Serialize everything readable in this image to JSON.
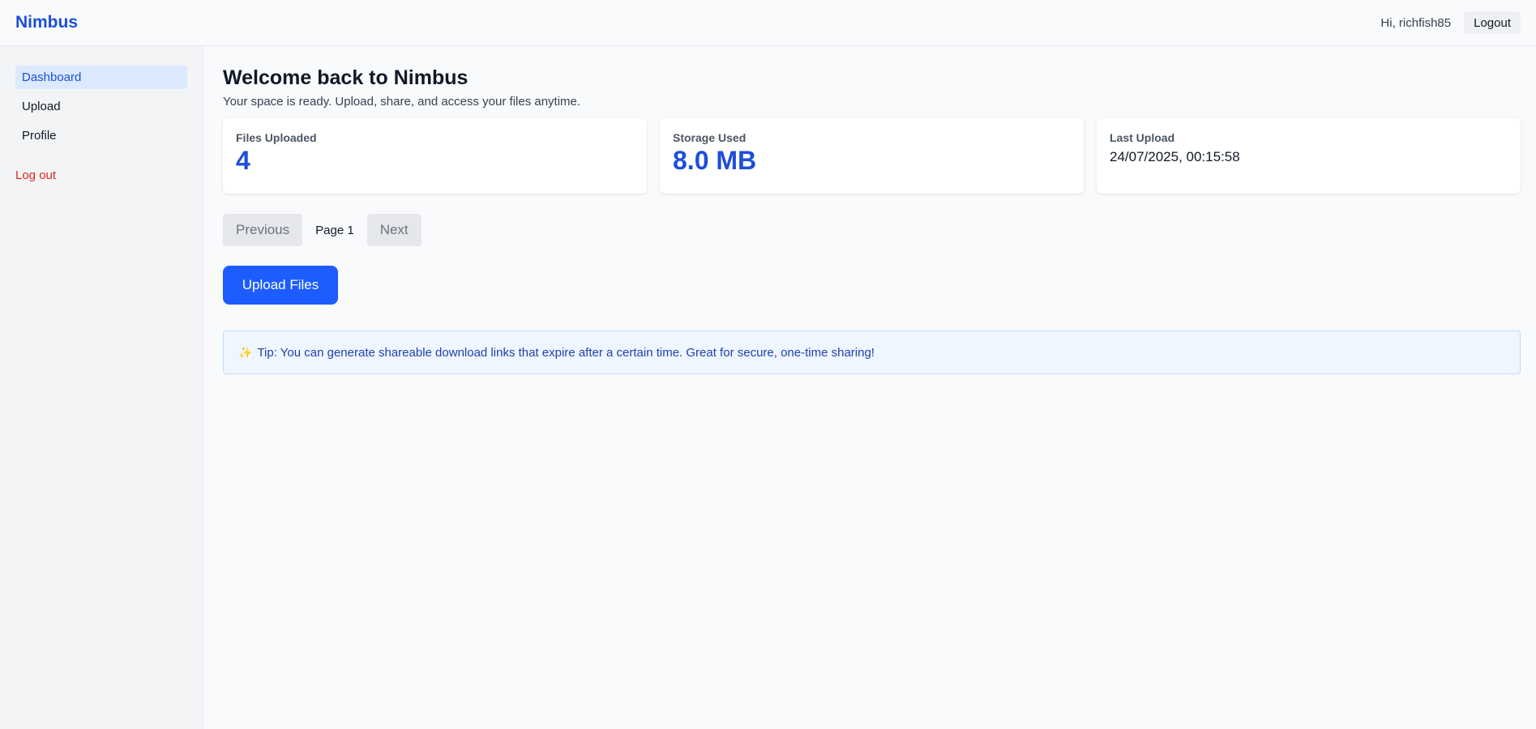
{
  "header": {
    "brand": "Nimbus",
    "greeting": "Hi, richfish85",
    "logout_label": "Logout"
  },
  "sidebar": {
    "items": [
      {
        "label": "Dashboard",
        "active": true
      },
      {
        "label": "Upload",
        "active": false
      },
      {
        "label": "Profile",
        "active": false
      }
    ],
    "logout_label": "Log out"
  },
  "main": {
    "title": "Welcome back to Nimbus",
    "subtitle": "Your space is ready. Upload, share, and access your files anytime.",
    "stats": [
      {
        "label": "Files Uploaded",
        "value": "4"
      },
      {
        "label": "Storage Used",
        "value": "8.0 MB"
      },
      {
        "label": "Last Upload",
        "value": "24/07/2025, 00:15:58"
      }
    ],
    "pager": {
      "previous_label": "Previous",
      "page_label": "Page 1",
      "next_label": "Next"
    },
    "upload_button_label": "Upload Files",
    "tip": {
      "icon": "sparkles-icon",
      "text": "Tip: You can generate shareable download links that expire after a certain time. Great for secure, one-time sharing!"
    }
  },
  "colors": {
    "accent": "#1d4ed8",
    "upload_button": "#1d5cff",
    "danger": "#dc2626",
    "tip_background": "#eff6ff"
  }
}
